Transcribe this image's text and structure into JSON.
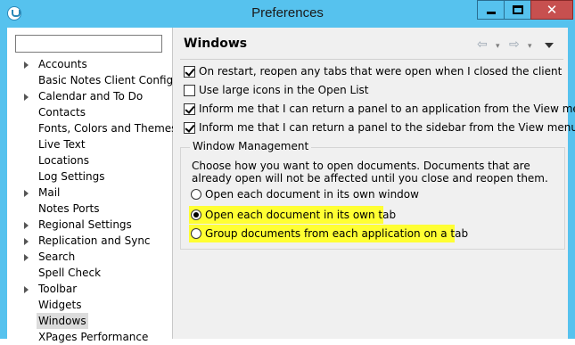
{
  "window": {
    "title": "Preferences",
    "close_glyph": "✕"
  },
  "tree": {
    "items": [
      {
        "label": "Accounts",
        "expandable": true
      },
      {
        "label": "Basic Notes Client Configu",
        "expandable": false
      },
      {
        "label": "Calendar and To Do",
        "expandable": true
      },
      {
        "label": "Contacts",
        "expandable": false
      },
      {
        "label": "Fonts, Colors and Themes",
        "expandable": false
      },
      {
        "label": "Live Text",
        "expandable": false
      },
      {
        "label": "Locations",
        "expandable": false
      },
      {
        "label": "Log Settings",
        "expandable": false
      },
      {
        "label": "Mail",
        "expandable": true
      },
      {
        "label": "Notes Ports",
        "expandable": false
      },
      {
        "label": "Regional Settings",
        "expandable": true
      },
      {
        "label": "Replication and Sync",
        "expandable": true
      },
      {
        "label": "Search",
        "expandable": true
      },
      {
        "label": "Spell Check",
        "expandable": false
      },
      {
        "label": "Toolbar",
        "expandable": true
      },
      {
        "label": "Widgets",
        "expandable": false
      },
      {
        "label": "Windows",
        "expandable": false,
        "selected": true
      },
      {
        "label": "XPages Performance",
        "expandable": false
      }
    ]
  },
  "panel": {
    "title": "Windows",
    "nav": {
      "back": "⇦",
      "forward": "⇨",
      "dropdown": "▾"
    },
    "checkboxes": [
      {
        "label": "On restart, reopen any tabs that were open when I closed the client",
        "checked": true
      },
      {
        "label": "Use large icons in the Open List",
        "checked": false
      },
      {
        "label": "Inform me that I can return a panel to an application from the View menu",
        "checked": true
      },
      {
        "label": "Inform me that I can return a panel to the sidebar from the View menu",
        "checked": true
      }
    ],
    "group": {
      "title": "Window Management",
      "description": "Choose how you want to open documents.  Documents that are already open will not be affected until you close and reopen them.",
      "options": [
        {
          "label": "Open each document in its own window",
          "selected": false,
          "highlighted": false
        },
        {
          "label": "Open each document in its own tab",
          "selected": true,
          "highlighted": true
        },
        {
          "label": "Group documents from each application on a tab",
          "selected": false,
          "highlighted": true
        }
      ]
    }
  },
  "colors": {
    "titlebar": "#56c2ee",
    "close_button": "#c7504f",
    "highlight": "#ffff33"
  }
}
